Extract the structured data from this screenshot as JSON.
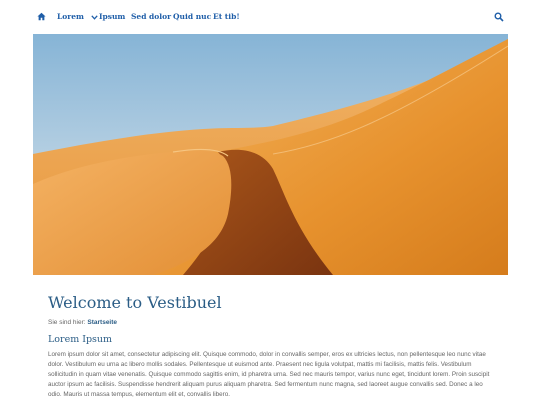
{
  "nav": {
    "items": [
      {
        "label": "Lorem",
        "has_dropdown": true
      },
      {
        "label": "Ipsum"
      },
      {
        "label": "Sed dolor"
      },
      {
        "label": "Quid nuc"
      },
      {
        "label": "Et tib!"
      }
    ],
    "icons": {
      "home": "home-icon",
      "search": "search-icon",
      "dropdown": "chevron-down-icon"
    },
    "accent_color": "#1f5ea8"
  },
  "hero": {
    "image": "desert-sand-dunes-photo"
  },
  "page": {
    "title": "Welcome to Vestibuel",
    "breadcrumb_prefix": "Sie sind hier:",
    "breadcrumb_link": "Startseite",
    "subheading": "Lorem Ipsum",
    "body": "Lorem ipsum dolor sit amet, consectetur adipiscing elit. Quisque commodo, dolor in convallis semper, eros ex ultricies lectus, non pellentesque leo nunc vitae dolor. Vestibulum eu urna ac libero mollis sodales. Pellentesque ut euismod ante. Praesent nec ligula volutpat, mattis mi facilisis, mattis felis. Vestibulum sollicitudin in quam vitae venenatis. Quisque commodo sagittis enim, id pharetra urna. Sed nec mauris tempor, varius nunc eget, tincidunt lorem. Proin suscipit auctor ipsum ac facilisis. Suspendisse hendrerit aliquam purus aliquam pharetra. Sed fermentum nunc magna, sed laoreet augue convallis sed. Donec a leo odio. Mauris ut massa tempus, elementum elit et, convallis libero."
  },
  "colors": {
    "heading": "#2b5d86",
    "text": "#666666"
  }
}
